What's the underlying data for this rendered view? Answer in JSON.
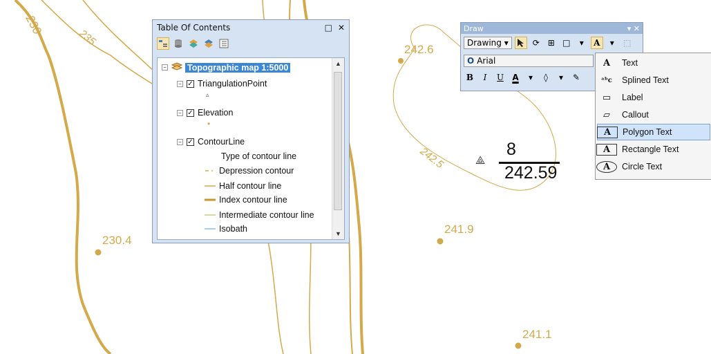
{
  "map": {
    "contour_labels": [
      "230",
      "235",
      "242.5"
    ],
    "elevation_points": [
      "242.6",
      "230.4",
      "241.9",
      "241.1"
    ],
    "annotation": {
      "number": "8",
      "elevation": "242.59"
    },
    "colors": {
      "contour": "#d4a94a",
      "point": "#d4a94a"
    }
  },
  "toc": {
    "title": "Table Of Contents",
    "controls": {
      "pin": "□",
      "close": "✕"
    },
    "toolbar_icons": [
      "list-by-drawing-order-icon",
      "list-by-source-icon",
      "list-by-visibility-icon",
      "list-by-selection-icon",
      "options-icon"
    ],
    "root": {
      "label": "Topographic map 1:5000"
    },
    "layers": [
      {
        "label": "TriangulationPoint",
        "symbol": "▵"
      },
      {
        "label": "Elevation",
        "symbol": "•"
      },
      {
        "label": "ContourLine",
        "legend_heading": "Type of contour line",
        "legend": [
          {
            "label": "Depression contour",
            "color": "#d4a94a",
            "style": "dash"
          },
          {
            "label": "Half contour line",
            "color": "#d4a94a",
            "style": "solid-thin"
          },
          {
            "label": "Index contour line",
            "color": "#d4a94a",
            "style": "solid-thick"
          },
          {
            "label": "Intermediate contour line",
            "color": "#d4a94a",
            "style": "solid"
          },
          {
            "label": "Isobath",
            "color": "#5b9bd5",
            "style": "solid"
          }
        ]
      }
    ]
  },
  "draw": {
    "title": "Draw",
    "drawing_menu": "Drawing",
    "font": "Arial",
    "format_labels": {
      "bold": "B",
      "italic": "I",
      "underline": "U",
      "font_color": "A"
    }
  },
  "text_menu": {
    "items": [
      {
        "label": "Text",
        "icon": "A",
        "highlighted": false
      },
      {
        "label": "Splined Text",
        "icon": "ᵃᵇc",
        "highlighted": false
      },
      {
        "label": "Label",
        "icon": "▭",
        "highlighted": false
      },
      {
        "label": "Callout",
        "icon": "▱",
        "highlighted": false
      },
      {
        "label": "Polygon Text",
        "icon": "A",
        "highlighted": true
      },
      {
        "label": "Rectangle Text",
        "icon": "A",
        "highlighted": false
      },
      {
        "label": "Circle Text",
        "icon": "A",
        "highlighted": false
      }
    ]
  }
}
